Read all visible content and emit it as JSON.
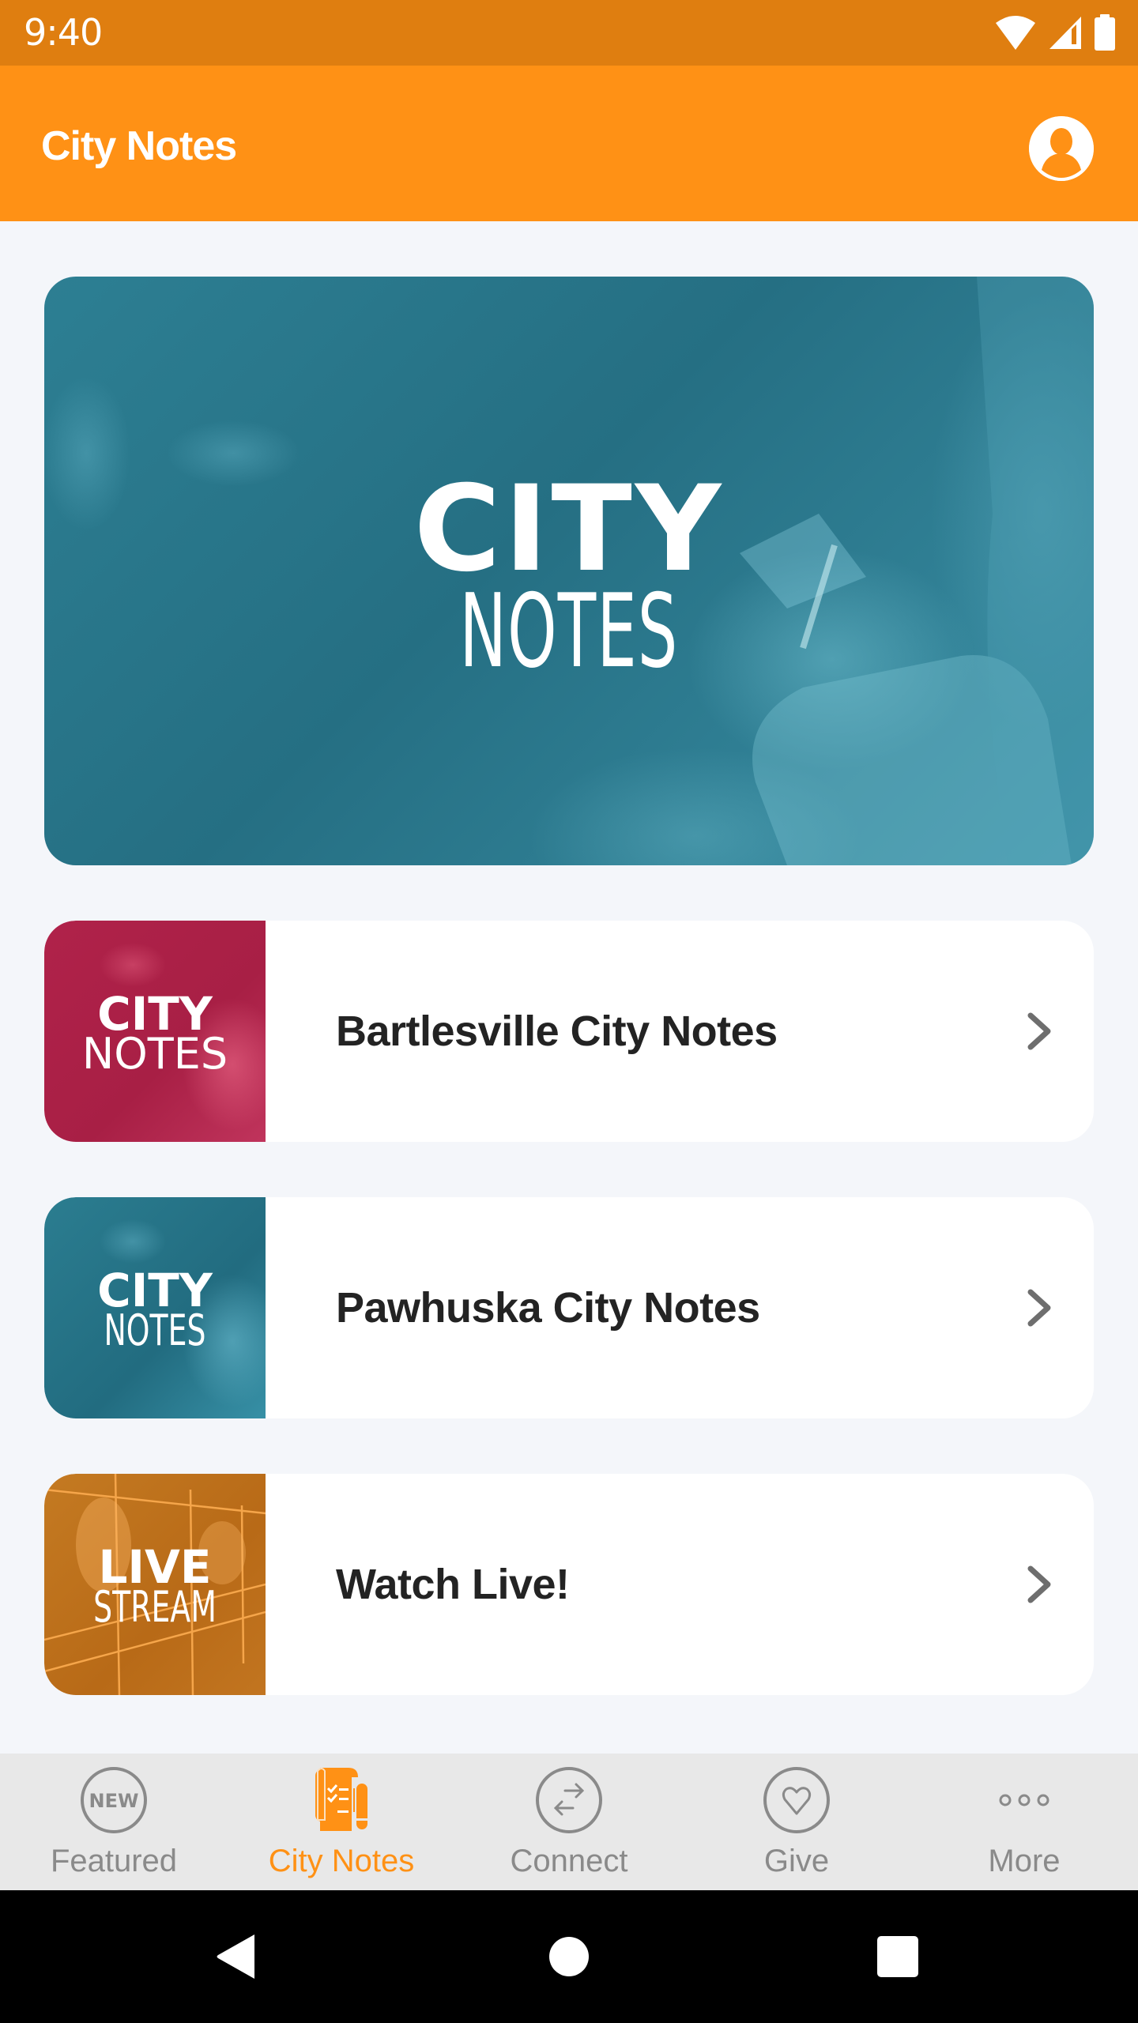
{
  "status_bar": {
    "time": "9:40",
    "icons": [
      "wifi-icon",
      "cellular-signal-icon",
      "battery-icon"
    ]
  },
  "header": {
    "title": "City Notes",
    "profile_icon": "account-circle-icon"
  },
  "banner": {
    "line1": "CITY",
    "line2": "NOTES",
    "tint": "#2D7F93"
  },
  "cards": [
    {
      "label": "Bartlesville City Notes",
      "thumb_line1": "CITY",
      "thumb_line2": "NOTES",
      "thumb_color": "#B0224A",
      "icon": "chevron-right-icon"
    },
    {
      "label": "Pawhuska City Notes",
      "thumb_line1": "CITY",
      "thumb_line2": "NOTES",
      "thumb_color": "#287A8E",
      "icon": "chevron-right-icon"
    },
    {
      "label": "Watch Live!",
      "thumb_line1": "LIVE",
      "thumb_line2": "STREAM",
      "thumb_color": "#BF7019",
      "icon": "chevron-right-icon"
    }
  ],
  "tab_bar": {
    "active_color": "#FF9115",
    "inactive_color": "#8A8A8A",
    "tabs": [
      {
        "label": "Featured",
        "icon": "new-badge-icon",
        "active": false,
        "icon_text": "NEW"
      },
      {
        "label": "City Notes",
        "icon": "notes-checklist-icon",
        "active": true
      },
      {
        "label": "Connect",
        "icon": "swap-arrows-icon",
        "active": false
      },
      {
        "label": "Give",
        "icon": "heart-icon",
        "active": false
      },
      {
        "label": "More",
        "icon": "more-dots-icon",
        "active": false
      }
    ]
  },
  "nav_bar": {
    "buttons": [
      "back-icon",
      "home-icon",
      "recents-icon"
    ]
  },
  "colors": {
    "status_bar": "#DF7E10",
    "header": "#FF9115",
    "background": "#F4F6FA",
    "card_text": "#232323",
    "chevron": "#6E6E6E"
  }
}
